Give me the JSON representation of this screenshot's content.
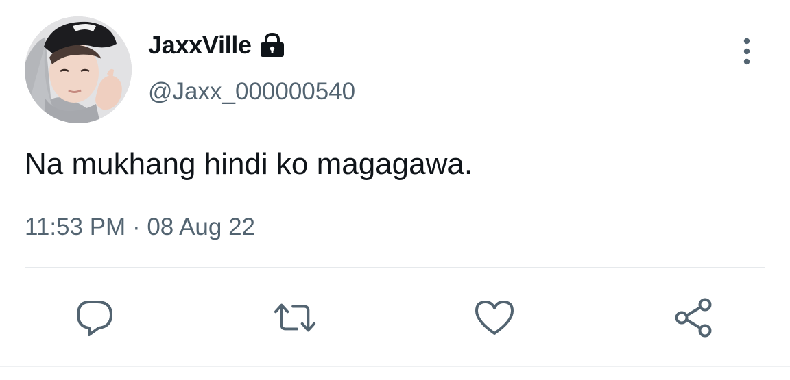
{
  "tweet": {
    "display_name": "JaxxVille",
    "handle": "@Jaxx_000000540",
    "text": "Na mukhang hindi ko magagawa.",
    "time": "11:53 PM",
    "separator": "·",
    "date": "08 Aug 22",
    "protected_icon": "lock-icon",
    "avatar": "profile-photo"
  },
  "actions": [
    {
      "name": "reply",
      "icon": "comment-bubble-icon"
    },
    {
      "name": "retweet",
      "icon": "retweet-arrows-icon"
    },
    {
      "name": "like",
      "icon": "heart-icon"
    },
    {
      "name": "share",
      "icon": "share-nodes-icon"
    }
  ],
  "menu_icon": "vertical-dots-icon",
  "colors": {
    "text_primary": "#0f1419",
    "text_secondary": "#536471",
    "icon": "#536471",
    "divider": "#e6e9ec",
    "background": "#ffffff"
  }
}
